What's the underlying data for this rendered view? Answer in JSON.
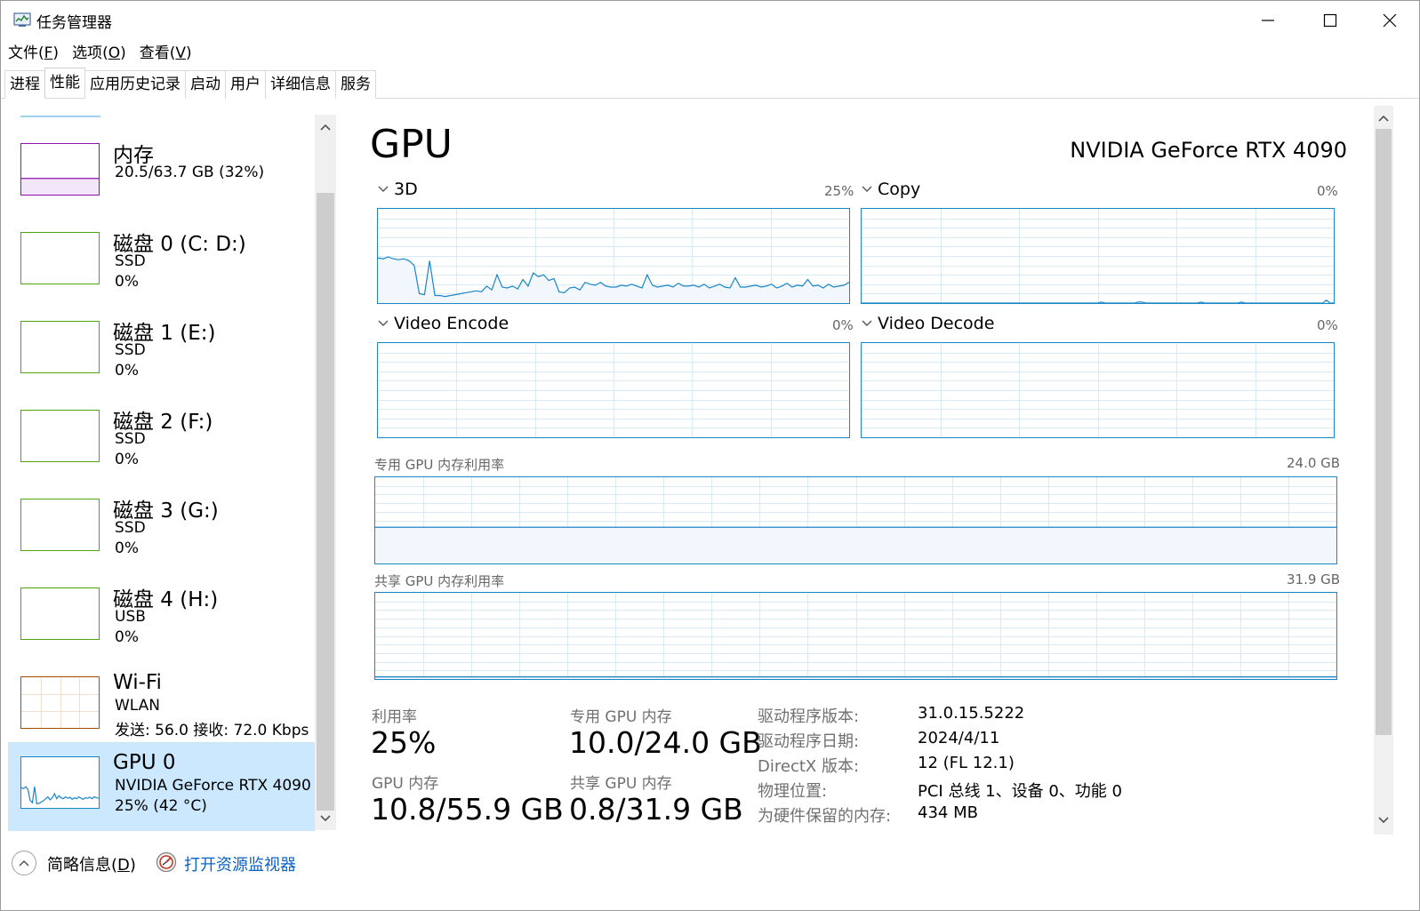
{
  "window": {
    "title": "任务管理器",
    "icons": {
      "app": "task-manager-icon",
      "minimize": "minimize-icon",
      "maximize": "maximize-icon",
      "close": "close-icon"
    }
  },
  "menu": [
    {
      "label": "文件",
      "key": "F"
    },
    {
      "label": "选项",
      "key": "O"
    },
    {
      "label": "查看",
      "key": "V"
    }
  ],
  "tabs": [
    {
      "label": "进程",
      "active": false
    },
    {
      "label": "性能",
      "active": true
    },
    {
      "label": "应用历史记录",
      "active": false
    },
    {
      "label": "启动",
      "active": false
    },
    {
      "label": "用户",
      "active": false
    },
    {
      "label": "详细信息",
      "active": false
    },
    {
      "label": "服务",
      "active": false
    }
  ],
  "sidebar": {
    "items": [
      {
        "name": "内存",
        "line1": "20.5/63.7 GB (32%)",
        "line2": "",
        "color": "#8b12ae",
        "fill": 0.32
      },
      {
        "name": "磁盘 0 (C: D:)",
        "line1": "SSD",
        "line2": "0%",
        "color": "#4da60c"
      },
      {
        "name": "磁盘 1 (E:)",
        "line1": "SSD",
        "line2": "0%",
        "color": "#4da60c"
      },
      {
        "name": "磁盘 2 (F:)",
        "line1": "SSD",
        "line2": "0%",
        "color": "#4da60c"
      },
      {
        "name": "磁盘 3 (G:)",
        "line1": "SSD",
        "line2": "0%",
        "color": "#4da60c"
      },
      {
        "name": "磁盘 4 (H:)",
        "line1": "USB",
        "line2": "0%",
        "color": "#4da60c"
      },
      {
        "name": "Wi-Fi",
        "line1": "WLAN",
        "line2": "发送: 56.0 接收: 72.0 Kbps",
        "color": "#a74f01"
      },
      {
        "name": "GPU 0",
        "line1": "NVIDIA GeForce RTX 4090",
        "line2": "25% (42 °C)",
        "color": "#1a86c7",
        "selected": true
      }
    ]
  },
  "gpu": {
    "title": "GPU",
    "model": "NVIDIA GeForce RTX 4090",
    "engines": [
      {
        "name": "3D",
        "percent": "25%"
      },
      {
        "name": "Copy",
        "percent": "0%"
      },
      {
        "name": "Video Encode",
        "percent": "0%"
      },
      {
        "name": "Video Decode",
        "percent": "0%"
      }
    ],
    "dedicated_mem": {
      "label": "专用 GPU 内存利用率",
      "max": "24.0 GB",
      "fraction": 0.42
    },
    "shared_mem": {
      "label": "共享 GPU 内存利用率",
      "max": "31.9 GB",
      "fraction": 0.025
    },
    "stats": [
      {
        "label": "利用率",
        "value": "25%"
      },
      {
        "label": "专用 GPU 内存",
        "value": "10.0/24.0 GB"
      },
      {
        "label": "GPU 内存",
        "value": "10.8/55.9 GB"
      },
      {
        "label": "共享 GPU 内存",
        "value": "0.8/31.9 GB"
      }
    ],
    "info": [
      {
        "label": "驱动程序版本:",
        "value": "31.0.15.5222"
      },
      {
        "label": "驱动程序日期:",
        "value": "2024/4/11"
      },
      {
        "label": "DirectX 版本:",
        "value": "12 (FL 12.1)"
      },
      {
        "label": "物理位置:",
        "value": "PCI 总线 1、设备 0、功能 0"
      },
      {
        "label": "为硬件保留的内存:",
        "value": "434 MB"
      }
    ],
    "history_3d": [
      48,
      47,
      49,
      47,
      46,
      47,
      45,
      40,
      10,
      9,
      45,
      8,
      8,
      7,
      8,
      9,
      10,
      11,
      12,
      13,
      12,
      18,
      14,
      30,
      17,
      16,
      18,
      15,
      25,
      18,
      32,
      28,
      30,
      24,
      26,
      12,
      11,
      16,
      17,
      14,
      22,
      20,
      19,
      22,
      18,
      17,
      17,
      19,
      18,
      20,
      18,
      16,
      30,
      19,
      17,
      18,
      19,
      17,
      21,
      18,
      18,
      19,
      17,
      20,
      16,
      18,
      20,
      17,
      16,
      27,
      17,
      17,
      18,
      19,
      17,
      18,
      20,
      16,
      18,
      21,
      17,
      19,
      18,
      25,
      18,
      19,
      16,
      20,
      17,
      18,
      19,
      22
    ],
    "history_copy": [
      0,
      0,
      0,
      0,
      0,
      0,
      0,
      0,
      0,
      0,
      0,
      0,
      0,
      0,
      0,
      0,
      0,
      0,
      0,
      0,
      0,
      0,
      0,
      0,
      0,
      0,
      0,
      0,
      0,
      0,
      0,
      0,
      0,
      0,
      0,
      0,
      0,
      0,
      0,
      0,
      0,
      0,
      0,
      0,
      0,
      0,
      0,
      0,
      0,
      0,
      0,
      0,
      0,
      0,
      0,
      0,
      0,
      0,
      0,
      0,
      0,
      0,
      0,
      0,
      0,
      1,
      0,
      0,
      0,
      0,
      0,
      0,
      0,
      0,
      0,
      1,
      1,
      0,
      0,
      0,
      0,
      0,
      0,
      0,
      0,
      0,
      0,
      0,
      0,
      0,
      0,
      0,
      1,
      0,
      0,
      0,
      0,
      0,
      0,
      0,
      0,
      0,
      0,
      1,
      0,
      0,
      0,
      0,
      0,
      0,
      0,
      0,
      0,
      0,
      0,
      0,
      0,
      0,
      0,
      0,
      0,
      0,
      0,
      0,
      0,
      0,
      3,
      0,
      0
    ],
    "history_gpu_thumb": [
      40,
      38,
      42,
      36,
      15,
      10,
      42,
      8,
      9,
      12,
      14,
      18,
      22,
      16,
      20,
      28,
      18,
      24,
      20,
      18,
      22,
      19,
      21,
      17,
      20,
      18,
      22,
      19,
      17,
      20,
      19,
      21,
      18,
      22,
      20,
      19
    ]
  },
  "footer": {
    "fewer_details": "简略信息",
    "fewer_key": "D",
    "resource_monitor": "打开资源监视器"
  }
}
